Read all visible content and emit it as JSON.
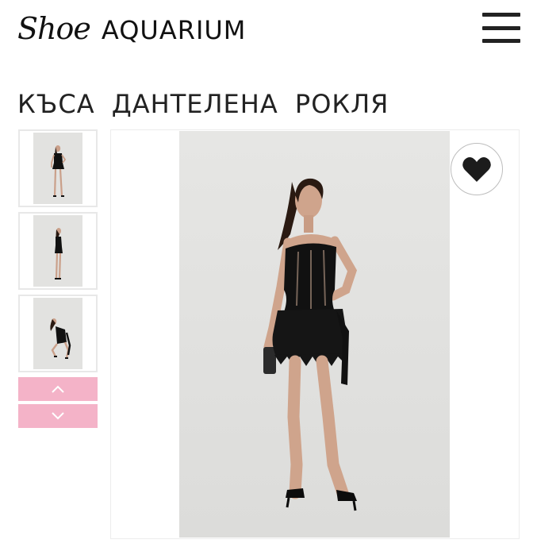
{
  "header": {
    "logo_script": "Shoe",
    "logo_word": "AQUARIUM",
    "menu_icon": "hamburger-icon"
  },
  "product": {
    "title": "КЪСА ДАНТЕЛЕНА РОКЛЯ",
    "favorite_icon": "heart-icon"
  },
  "gallery": {
    "thumbnails": [
      {
        "pose": "front"
      },
      {
        "pose": "side"
      },
      {
        "pose": "crouching"
      }
    ],
    "up_icon": "chevron-up-icon",
    "down_icon": "chevron-down-icon"
  },
  "colors": {
    "accent_pink": "#f4b3c8",
    "photo_bg": "#e2e2e0",
    "dress": "#111111",
    "text": "#222222"
  }
}
